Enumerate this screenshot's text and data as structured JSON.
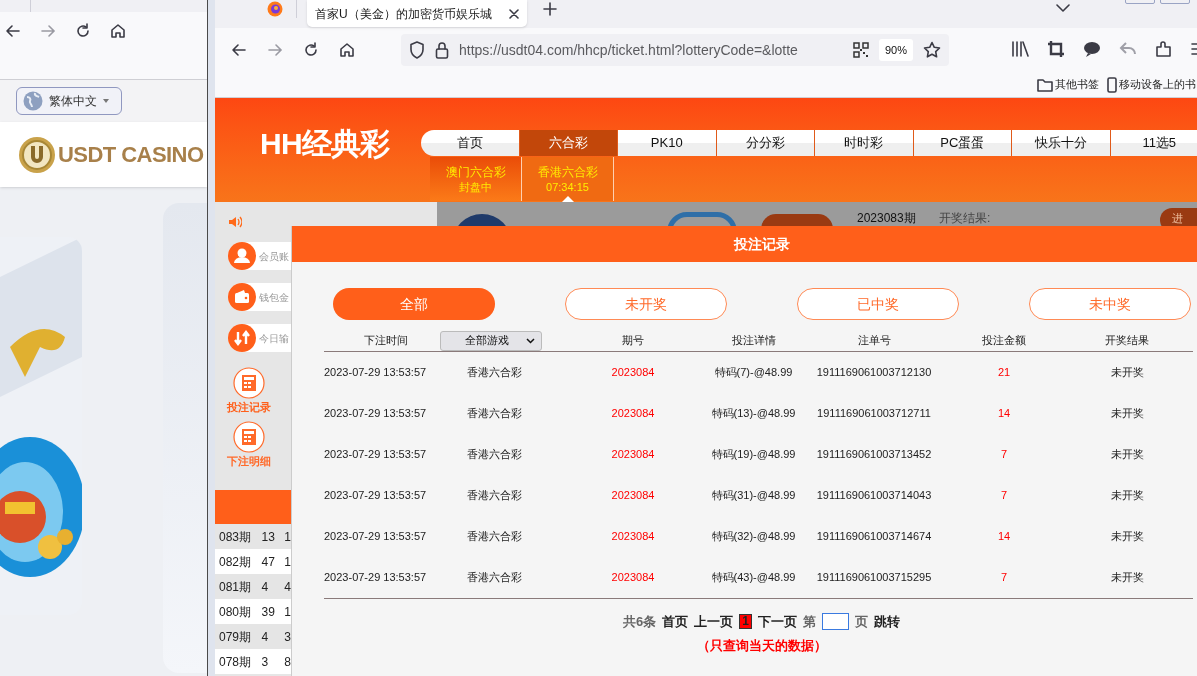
{
  "left_window": {
    "language_button": {
      "label": "繁体中文"
    },
    "logo": {
      "text": "USDT CASINO"
    }
  },
  "browser": {
    "tab": {
      "title": "首家U（美金）的加密货币娱乐城",
      "selected": true
    },
    "url": "https://usdt04.com/hhcp/ticket.html?lotteryCode=&lotte",
    "zoom": "90%",
    "bookmarks": [
      {
        "kind": "folder",
        "label": "其他书签"
      },
      {
        "kind": "device",
        "label": "移动设备上的书"
      }
    ]
  },
  "site": {
    "logo": "HH经典彩",
    "nav": [
      {
        "label": "首页",
        "selected": false
      },
      {
        "label": "六合彩",
        "selected": true
      },
      {
        "label": "PK10",
        "selected": false
      },
      {
        "label": "分分彩",
        "selected": false
      },
      {
        "label": "时时彩",
        "selected": false
      },
      {
        "label": "PC蛋蛋",
        "selected": false
      },
      {
        "label": "快乐十分",
        "selected": false
      },
      {
        "label": "11选5",
        "selected": false
      }
    ],
    "sub_menu": [
      {
        "name": "澳门六合彩",
        "status": "封盘中",
        "selected": false
      },
      {
        "name": "香港六合彩",
        "status": "07:34:15",
        "selected": true
      }
    ],
    "backdrop": {
      "period": "2023083期",
      "result_label": "开奖结果:",
      "button_label": "进"
    },
    "sidebar": {
      "stats": [
        {
          "kind": "user",
          "label": "会员账"
        },
        {
          "kind": "wallet",
          "label": "钱包金"
        },
        {
          "kind": "exchange",
          "label": "今日输"
        }
      ],
      "links": [
        {
          "label": "投注记录",
          "selected": true
        },
        {
          "label": "下注明细",
          "selected": false
        }
      ],
      "results": [
        {
          "period": "083期",
          "n1": "13",
          "n2": "1"
        },
        {
          "period": "082期",
          "n1": "47",
          "n2": "1"
        },
        {
          "period": "081期",
          "n1": "4",
          "n2": "4"
        },
        {
          "period": "080期",
          "n1": "39",
          "n2": "1"
        },
        {
          "period": "079期",
          "n1": "4",
          "n2": "3"
        },
        {
          "period": "078期",
          "n1": "3",
          "n2": "8"
        }
      ]
    }
  },
  "modal": {
    "title": "投注记录",
    "filters": [
      {
        "label": "全部",
        "selected": true
      },
      {
        "label": "未开奖",
        "selected": false
      },
      {
        "label": "已中奖",
        "selected": false
      },
      {
        "label": "未中奖",
        "selected": false
      }
    ],
    "columns": [
      "下注时间",
      "全部游戏",
      "期号",
      "投注详情",
      "注单号",
      "投注金额",
      "开奖结果"
    ],
    "rows": [
      [
        "2023-07-29 13:53:57",
        "香港六合彩",
        "2023084",
        "特码(7)-@48.99",
        "1911169061003712130",
        "21",
        "未开奖"
      ],
      [
        "2023-07-29 13:53:57",
        "香港六合彩",
        "2023084",
        "特码(13)-@48.99",
        "1911169061003712711",
        "14",
        "未开奖"
      ],
      [
        "2023-07-29 13:53:57",
        "香港六合彩",
        "2023084",
        "特码(19)-@48.99",
        "1911169061003713452",
        "7",
        "未开奖"
      ],
      [
        "2023-07-29 13:53:57",
        "香港六合彩",
        "2023084",
        "特码(31)-@48.99",
        "1911169061003714043",
        "7",
        "未开奖"
      ],
      [
        "2023-07-29 13:53:57",
        "香港六合彩",
        "2023084",
        "特码(32)-@48.99",
        "1911169061003714674",
        "14",
        "未开奖"
      ],
      [
        "2023-07-29 13:53:57",
        "香港六合彩",
        "2023084",
        "特码(43)-@48.99",
        "1911169061003715295",
        "7",
        "未开奖"
      ]
    ],
    "pagination": {
      "total": "共6条",
      "first": "首页",
      "prev": "上一页",
      "current": "1",
      "next": "下一页",
      "page_prefix": "第",
      "page_suffix": "页",
      "go": "跳转"
    },
    "note": "（只查询当天的数据）"
  }
}
